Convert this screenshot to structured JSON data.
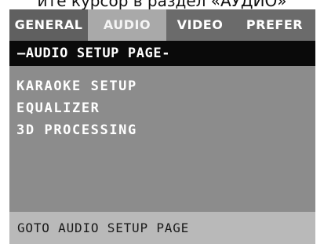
{
  "caption": "ите курсор в раздел «АУДИО»",
  "tabs": [
    {
      "label": "GENERAL"
    },
    {
      "label": "AUDIO"
    },
    {
      "label": "VIDEO"
    },
    {
      "label": "PREFER"
    }
  ],
  "page": {
    "header": "—AUDIO SETUP PAGE-",
    "menu": [
      {
        "label": "KARAOKE SETUP"
      },
      {
        "label": "EQUALIZER"
      },
      {
        "label": "3D PROCESSING"
      }
    ]
  },
  "status": "GOTO AUDIO SETUP PAGE",
  "colors": {
    "active_tab": "#a9a9a9",
    "header_bg": "#0a0a0a",
    "panel_bg": "#8c8c8c",
    "status_bg": "#b9b9b9"
  }
}
